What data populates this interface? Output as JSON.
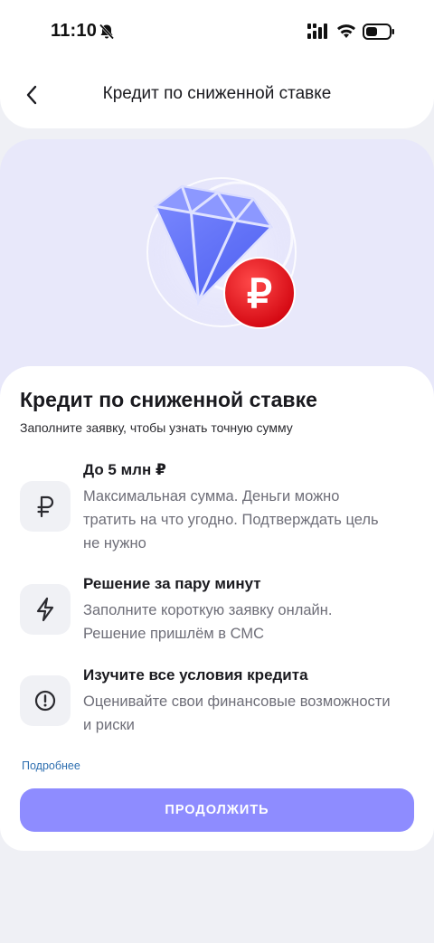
{
  "status_bar": {
    "time": "11:10",
    "icons": [
      "bell-muted-icon",
      "signal-icon",
      "wifi-icon",
      "battery-icon"
    ]
  },
  "header": {
    "back_icon": "chevron-left-icon",
    "title": "Кредит по сниженной ставке"
  },
  "hero": {
    "illustration": "diamond-ruble-illustration"
  },
  "content": {
    "title": "Кредит по сниженной ставке",
    "subtitle": "Заполните заявку, чтобы узнать точную сумму",
    "features": [
      {
        "icon": "ruble-icon",
        "title": "До 5 млн ₽",
        "description": "Максимальная сумма. Деньги можно тратить на что угодно. Подтверждать цель не нужно"
      },
      {
        "icon": "lightning-icon",
        "title": "Решение за пару минут",
        "description": "Заполните короткую заявку онлайн. Решение пришлём в СМС"
      },
      {
        "icon": "info-circle-icon",
        "title": "Изучите все условия кредита",
        "description": "Оценивайте свои финансовые возможности и риски"
      }
    ],
    "more_link": "Подробнее",
    "continue_label": "ПРОДОЛЖИТЬ"
  },
  "colors": {
    "accent_button": "#8e8cff",
    "hero_background": "#e8e8fa",
    "link": "#2e6fb0",
    "ruble_coin": "#e8131b"
  }
}
